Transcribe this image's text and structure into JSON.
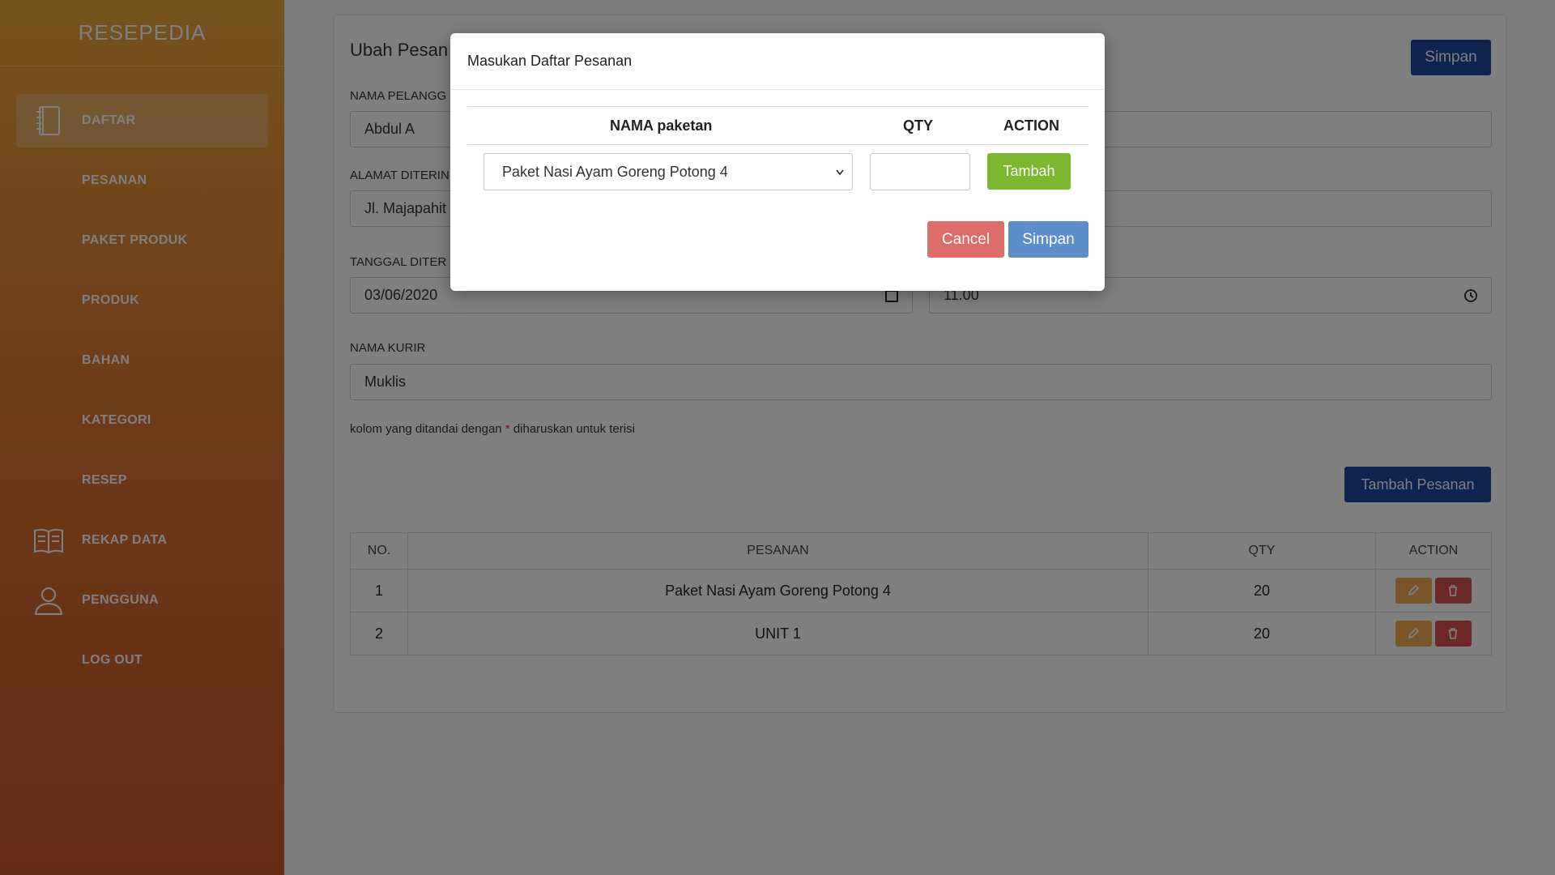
{
  "sidebar": {
    "brand": "RESEPEDIA",
    "items": [
      {
        "label": "DAFTAR",
        "icon": "notebook-icon",
        "active": true
      },
      {
        "label": "PESANAN",
        "icon": ""
      },
      {
        "label": "PAKET PRODUK",
        "icon": ""
      },
      {
        "label": "PRODUK",
        "icon": ""
      },
      {
        "label": "BAHAN",
        "icon": ""
      },
      {
        "label": "KATEGORI",
        "icon": ""
      },
      {
        "label": "RESEP",
        "icon": ""
      },
      {
        "label": "REKAP DATA",
        "icon": "book-open-icon"
      },
      {
        "label": "PENGGUNA",
        "icon": "user-icon"
      },
      {
        "label": "LOG OUT",
        "icon": ""
      }
    ]
  },
  "main": {
    "title": "Ubah Pesan",
    "save_label": "Simpan",
    "customer_label": "NAMA PELANGG",
    "customer_value": "Abdul A",
    "address_label": "ALAMAT DITERIN",
    "address_value": "Jl. Majapahit",
    "date_label": "TANGGAL DITER",
    "date_value": "03/06/2020",
    "time_value": "11.00",
    "courier_label": "NAMA KURIR",
    "courier_value": "Muklis",
    "hint_before": "kolom yang ditandai dengan ",
    "hint_star": "*",
    "hint_after": " diharuskan untuk terisi",
    "add_order_label": "Tambah Pesanan",
    "table": {
      "headers": [
        "NO.",
        "PESANAN",
        "QTY",
        "ACTION"
      ],
      "rows": [
        {
          "no": "1",
          "pesanan": "Paket Nasi Ayam Goreng Potong 4",
          "qty": "20"
        },
        {
          "no": "2",
          "pesanan": "UNIT 1",
          "qty": "20"
        }
      ]
    }
  },
  "modal": {
    "title": "Masukan Daftar Pesanan",
    "headers": {
      "name": "NAMA paketan",
      "qty": "QTY",
      "action": "ACTION"
    },
    "selected_package": "Paket Nasi Ayam Goreng Potong 4",
    "qty_value": "",
    "add_label": "Tambah",
    "cancel_label": "Cancel",
    "save_label": "Simpan"
  }
}
